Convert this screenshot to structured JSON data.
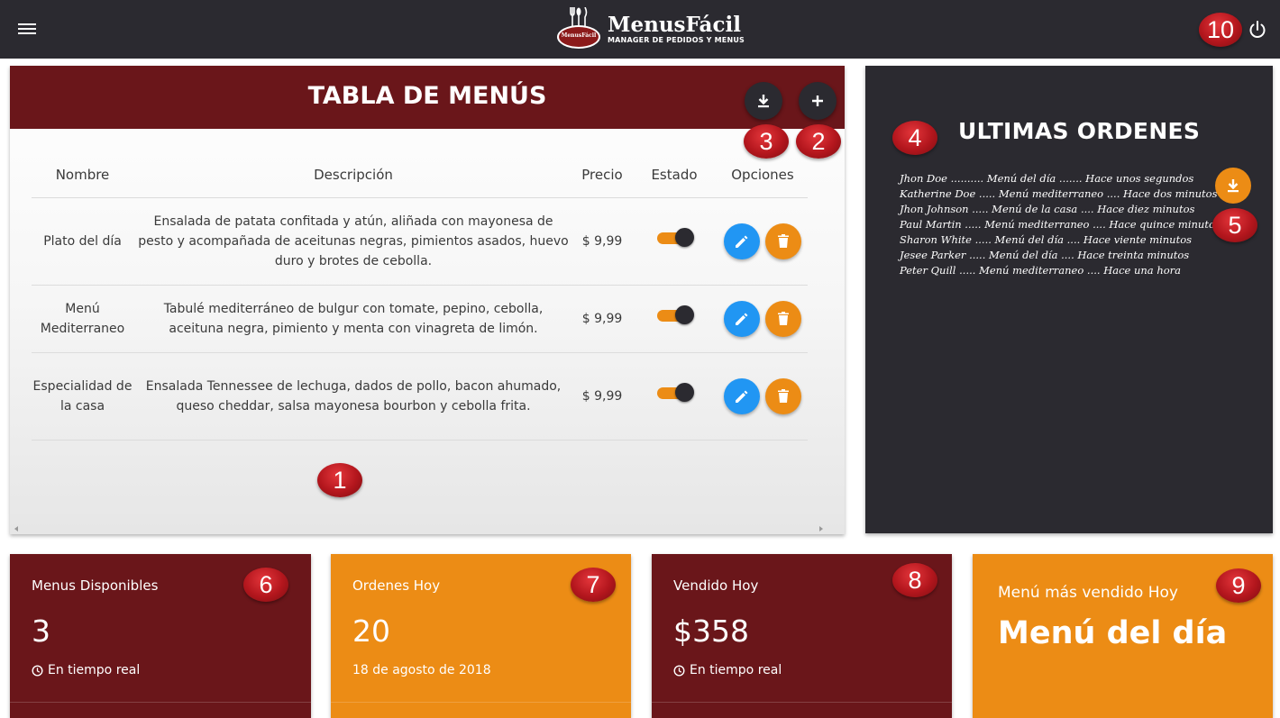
{
  "header": {
    "brand": "MenusFácil",
    "tagline": "MANAGER DE PEDIDOS Y MENUS",
    "badge": "MenusFácil",
    "icons": {
      "menu": "hamburger-icon",
      "power": "power-icon"
    }
  },
  "table": {
    "title": "TABLA DE MENÚS",
    "columns": [
      "Nombre",
      "Descripción",
      "Precio",
      "Estado",
      "Opciones"
    ],
    "rows": [
      {
        "name": "Plato del día",
        "description": "Ensalada de patata confitada y atún, aliñada con mayonesa de pesto y acompañada de aceitunas negras, pimientos asados, huevo duro y brotes de cebolla.",
        "price": "$ 9,99",
        "active": true
      },
      {
        "name": "Menú Mediterraneo",
        "description": "Tabulé mediterráneo de bulgur con tomate, pepino, cebolla, aceituna negra, pimiento y menta con vinagreta de limón.",
        "price": "$ 9,99",
        "active": true
      },
      {
        "name": "Especialidad de la casa",
        "description": "Ensalada Tennessee de lechuga, dados de pollo, bacon ahumado, queso cheddar, salsa mayonesa bourbon y cebolla frita.",
        "price": "$ 9,99",
        "active": true
      }
    ],
    "icons": {
      "download": "download-icon",
      "add": "plus-icon",
      "edit": "pencil-icon",
      "delete": "trash-icon"
    }
  },
  "orders": {
    "title": "ULTIMAS ORDENES",
    "items": [
      "Jhon Doe .......... Menú del día ....... Hace unos segundos",
      "Katherine Doe ..... Menú mediterraneo .... Hace dos minutos",
      "Jhon Johnson ..... Menú de la casa .... Hace diez minutos",
      "Paul Martin ..... Menú mediterraneo .... Hace quince minutos",
      "Sharon White ..... Menú del día .... Hace viente minutos",
      "Jesee Parker ..... Menú del día .... Hace treinta minutos",
      "Peter Quill ..... Menú mediterraneo .... Hace una hora"
    ]
  },
  "stats": [
    {
      "title": "Menus Disponibles",
      "value": "3",
      "foot": "En tiempo real"
    },
    {
      "title": "Ordenes Hoy",
      "value": "20",
      "foot": "18 de agosto de 2018"
    },
    {
      "title": "Vendido Hoy",
      "value": "$358",
      "foot": "En tiempo real"
    },
    {
      "title": "Menú más vendido Hoy",
      "value": "Menú del día"
    }
  ],
  "markers": [
    "1",
    "2",
    "3",
    "4",
    "5",
    "6",
    "7",
    "8",
    "9",
    "10"
  ],
  "colors": {
    "topbar": "#2b2a30",
    "maroon": "#6a161a",
    "orange": "#ec8c15",
    "blue": "#2196f3",
    "marker": "#b3161d"
  }
}
